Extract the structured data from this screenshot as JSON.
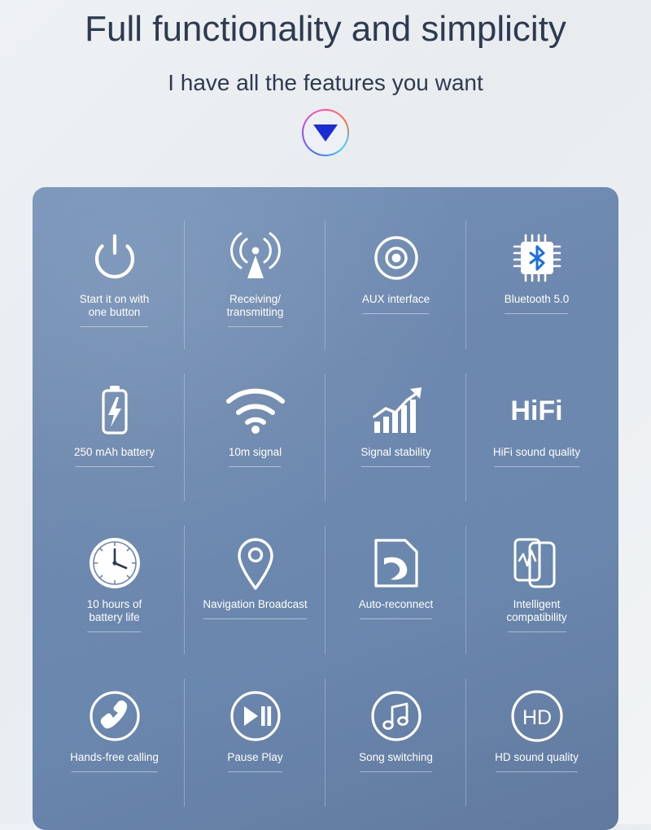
{
  "header": {
    "title": "Full functionality and simplicity",
    "subtitle": "I have all the features you want",
    "arrow_icon": "chevron-down-icon"
  },
  "colors": {
    "page_background": "#eef1f4",
    "heading_text": "#2d3a4f",
    "panel_gradient_from": "#7592b8",
    "panel_gradient_to": "#62799e",
    "feature_text": "#ffffff",
    "bluetooth_blue": "#1a6fe0"
  },
  "features": [
    {
      "icon": "power-button-icon",
      "label": "Start it on with one button",
      "label_lines": [
        "Start it on with",
        "one button"
      ]
    },
    {
      "icon": "broadcast-tower-icon",
      "label": "Receiving/ transmitting",
      "label_lines": [
        "Receiving/",
        "transmitting"
      ]
    },
    {
      "icon": "aux-jack-icon",
      "label": "AUX interface",
      "label_lines": [
        "AUX interface"
      ]
    },
    {
      "icon": "bluetooth-chip-icon",
      "label": "Bluetooth 5.0",
      "label_lines": [
        "Bluetooth 5.0"
      ]
    },
    {
      "icon": "battery-charging-icon",
      "label": "250 mAh battery",
      "label_lines": [
        "250 mAh battery"
      ]
    },
    {
      "icon": "wifi-signal-icon",
      "label": "10m signal",
      "label_lines": [
        "10m signal"
      ]
    },
    {
      "icon": "growth-chart-icon",
      "label": "Signal stability",
      "label_lines": [
        "Signal stability"
      ]
    },
    {
      "icon": "hifi-text-icon",
      "label": "HiFi sound quality",
      "label_lines": [
        "HiFi sound quality"
      ],
      "glyph_text": "HiFi"
    },
    {
      "icon": "wall-clock-icon",
      "label": "10 hours of battery life",
      "label_lines": [
        "10 hours of",
        "battery life"
      ]
    },
    {
      "icon": "map-pin-icon",
      "label": "Navigation Broadcast",
      "label_lines": [
        "Navigation Broadcast"
      ]
    },
    {
      "icon": "auto-reconnect-icon",
      "label": "Auto-reconnect",
      "label_lines": [
        "Auto-reconnect"
      ]
    },
    {
      "icon": "phone-compatibility-icon",
      "label": "Intelligent compatibility",
      "label_lines": [
        "Intelligent",
        "compatibility"
      ]
    },
    {
      "icon": "handset-call-icon",
      "label": "Hands-free calling",
      "label_lines": [
        "Hands-free calling"
      ]
    },
    {
      "icon": "play-pause-icon",
      "label": "Pause Play",
      "label_lines": [
        "Pause Play"
      ]
    },
    {
      "icon": "music-note-icon",
      "label": "Song switching",
      "label_lines": [
        "Song switching"
      ]
    },
    {
      "icon": "hd-badge-icon",
      "label": "HD sound quality",
      "label_lines": [
        "HD sound quality"
      ],
      "glyph_text": "HD"
    }
  ]
}
